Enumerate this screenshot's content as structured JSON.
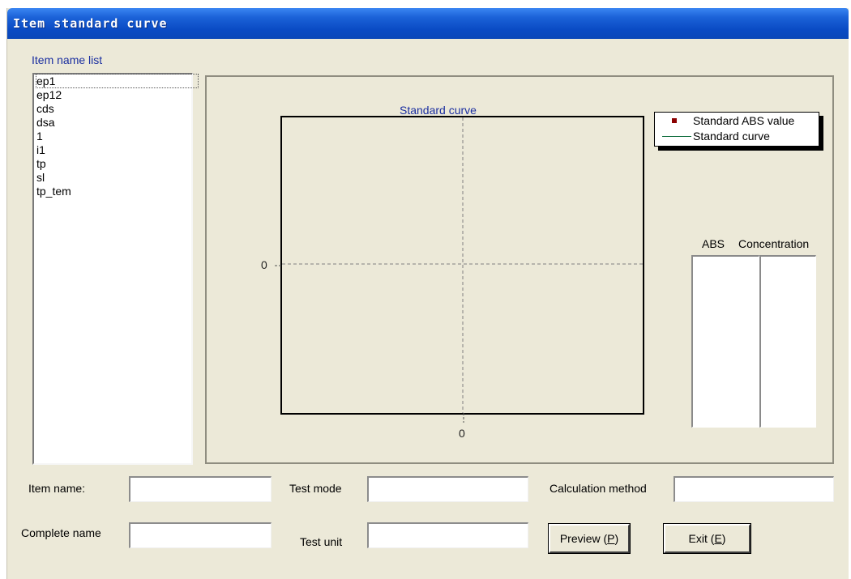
{
  "window": {
    "title": "Item standard curve"
  },
  "item_list": {
    "caption": "Item name list",
    "items": [
      "ep1",
      "ep12",
      "cds",
      "dsa",
      "1",
      "i1",
      "tp",
      "sl",
      "tp_tem"
    ]
  },
  "chart": {
    "title": "Standard curve",
    "y_zero_label": "0",
    "x_zero_label": "0",
    "legend": {
      "marker_series": "Standard ABS value",
      "line_series": "Standard curve"
    }
  },
  "data_grid": {
    "columns": [
      "ABS",
      "Concentration"
    ]
  },
  "form": {
    "item_name_label": "Item name:",
    "test_mode_label": "Test mode",
    "calculation_method_label": "Calculation method",
    "complete_name_label": "Complete name",
    "test_unit_label": "Test unit",
    "item_name_value": "",
    "test_mode_value": "",
    "calculation_method_value": "",
    "complete_name_value": "",
    "test_unit_value": ""
  },
  "buttons": {
    "preview_text": "Preview (",
    "preview_key": "P",
    "exit_text": "Exit (",
    "exit_key": "E",
    "close_paren": ")"
  },
  "colors": {
    "titlebar": "#0a4bc4",
    "window_bg": "#ece9d8",
    "caption_text": "#1a2ea0",
    "marker": "#8b0000",
    "curve": "#0b6b3a"
  }
}
